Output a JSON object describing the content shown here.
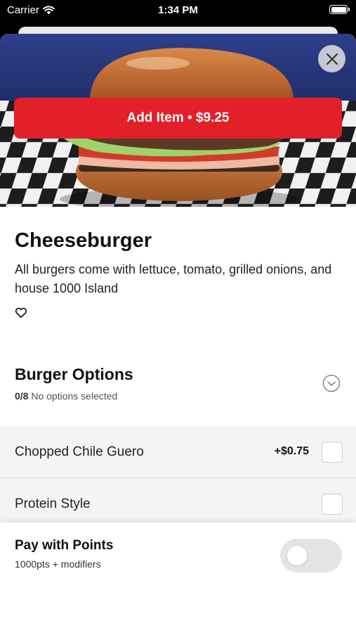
{
  "status_bar": {
    "carrier": "Carrier",
    "time": "1:34 PM"
  },
  "item": {
    "name": "Cheeseburger",
    "description": "All burgers come with lettuce, tomato, grilled onions, and house 1000 Island",
    "image": "cheeseburger-photo"
  },
  "options": {
    "title": "Burger Options",
    "count": "0/8",
    "summary": "No options selected",
    "items": [
      {
        "label": "Chopped Chile Guero",
        "price": "+$0.75",
        "checked": false
      },
      {
        "label": "Protein Style",
        "price": "",
        "checked": false
      }
    ]
  },
  "points": {
    "title": "Pay with Points",
    "subtitle": "1000pts + modifiers",
    "enabled": false
  },
  "cta": {
    "label": "Add Item • $9.25"
  },
  "icons": {
    "close": "close-icon",
    "favorite": "heart-icon",
    "expand": "chevron-down-icon",
    "wifi": "wifi-icon",
    "battery": "battery-icon"
  },
  "colors": {
    "accent": "#e3202a",
    "row_bg": "#f4f4f4",
    "toggle_off": "#e4e4e6"
  }
}
